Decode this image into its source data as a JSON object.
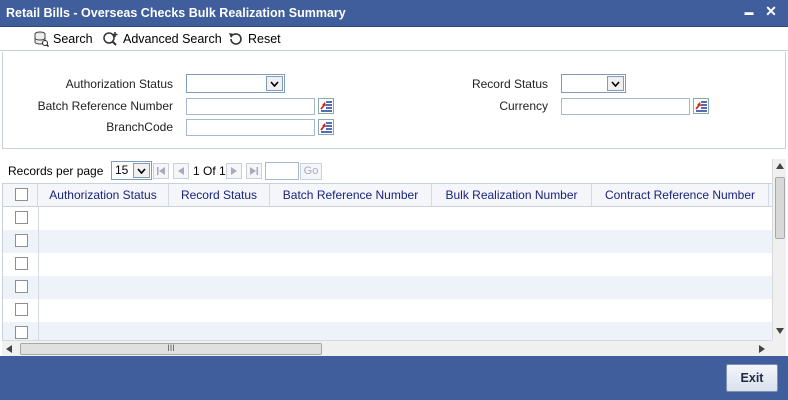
{
  "window": {
    "title": "Retail Bills - Overseas Checks Bulk Realization Summary",
    "minimize": "▬",
    "close": "✕"
  },
  "toolbar": {
    "search": "Search",
    "advanced_search": "Advanced Search",
    "reset": "Reset"
  },
  "criteria": {
    "authorization_status_label": "Authorization Status",
    "authorization_status_value": "",
    "batch_reference_label": "Batch Reference Number",
    "batch_reference_value": "",
    "branch_code_label": "BranchCode",
    "branch_code_value": "",
    "record_status_label": "Record Status",
    "record_status_value": "",
    "currency_label": "Currency",
    "currency_value": ""
  },
  "grid": {
    "records_per_page_label": "Records per page",
    "records_per_page": "15",
    "page_info": "1 Of 1",
    "go_label": "Go",
    "columns": [
      "Authorization Status",
      "Record Status",
      "Batch Reference Number",
      "Bulk Realization Number",
      "Contract Reference Number"
    ],
    "scroll_thumb_grip": "III"
  },
  "footer": {
    "exit": "Exit"
  },
  "colors": {
    "header_blue": "#3f5e9b",
    "column_text": "#1a237e",
    "row_alt": "#eef3fa"
  }
}
